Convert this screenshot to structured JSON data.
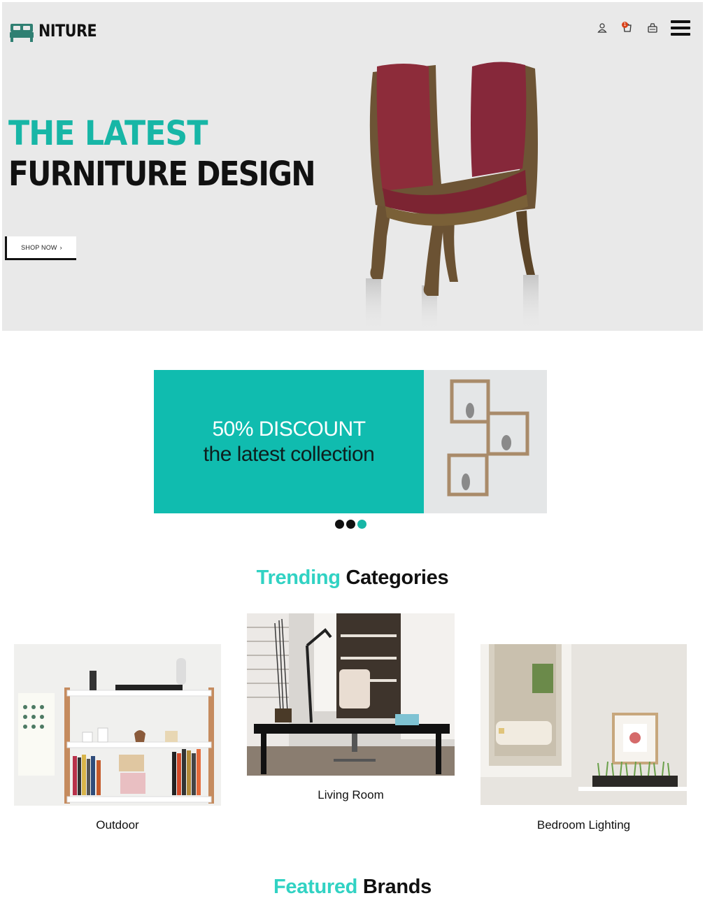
{
  "brand": {
    "name": "NITURE",
    "logo_icon": "bed-icon"
  },
  "header": {
    "icons": [
      "user-icon",
      "cart-icon",
      "bag-icon",
      "menu-icon"
    ],
    "cart_count": "1"
  },
  "hero": {
    "title_line1": "THE LATEST",
    "title_line2": "FURNITURE DESIGN",
    "cta_label": "SHOP NOW",
    "cta_icon": "chevron-right-icon"
  },
  "promo": {
    "line1": "50% DISCOUNT",
    "line2": "the latest collection",
    "background_color": "#10bcaf"
  },
  "carousel": {
    "slides": 3,
    "active_index": 2
  },
  "trending": {
    "title_accent": "Trending",
    "title_rest": "Categories",
    "cards": [
      {
        "label": "Outdoor"
      },
      {
        "label": "Living Room"
      },
      {
        "label": "Bedroom Lighting"
      }
    ]
  },
  "featured": {
    "title_accent": "Featured",
    "title_rest": "Brands"
  },
  "colors": {
    "accent": "#17b6a6",
    "accent_light": "#31d2c3",
    "promo": "#10bcaf",
    "text": "#111111"
  }
}
